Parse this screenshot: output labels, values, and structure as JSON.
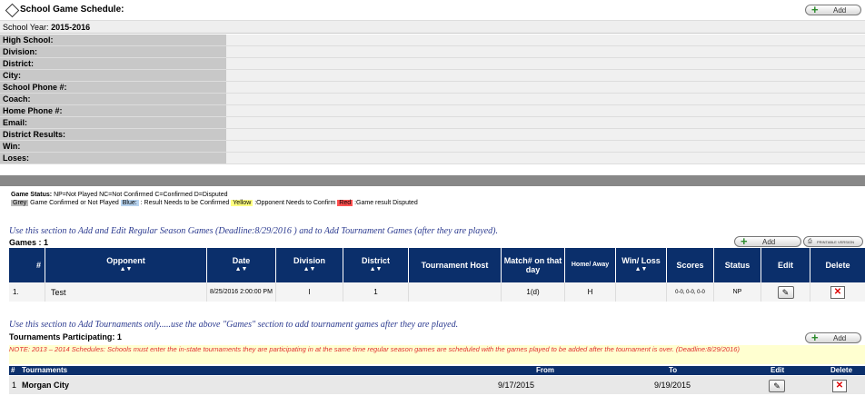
{
  "header": {
    "title": "School Game Schedule:",
    "add_label": "Add"
  },
  "school_year": {
    "label": "School Year:",
    "value": "2015-2016"
  },
  "info_fields": [
    "High School:",
    "Division:",
    "District:",
    "City:",
    "School Phone #:",
    "Coach:",
    "Home Phone #:",
    "Email:",
    "District Results:",
    "Win:",
    "Loses:"
  ],
  "legend": {
    "status_title": "Game Status:",
    "status_text": "NP=Not Played NC=Not Confirmed C=Confirmed D=Disputed",
    "grey": "Grey",
    "grey_text": "Game Confirmed or Not Played",
    "blue": "Blue:",
    "blue_text": ": Result Needs to be Confirmed",
    "yellow": "Yellow",
    "yellow_text": ":Opponent Needs to Confirm",
    "red": "Red",
    "red_text": ":Game result Disputed"
  },
  "games": {
    "instruction": "Use this section to Add and Edit Regular Season Games (Deadline:8/29/2016 ) and to Add Tournament Games (after they are played).",
    "count_label": "Games : 1",
    "add_label": "Add",
    "printable_label": "PRINTABLE VERSION",
    "columns": [
      "#",
      "Opponent",
      "Date",
      "Division",
      "District",
      "Tournament Host",
      "Match# on that day",
      "Home/ Away",
      "Win/ Loss",
      "Scores",
      "Status",
      "Edit",
      "Delete"
    ],
    "sort_arrows": "▲▼",
    "rows": [
      {
        "num": "1.",
        "opponent": "Test",
        "date": "8/25/2016 2:00:00 PM",
        "division": "I",
        "district": "1",
        "host": "",
        "match": "1(d)",
        "home_away": "H",
        "win_loss": "",
        "scores": "0-0, 0-0, 0-0",
        "status": "NP"
      }
    ]
  },
  "tournaments": {
    "instruction": "Use this section to Add Tournaments only.....use the above \"Games\" section to add tournament games after they are played.",
    "count_label": "Tournaments Participating: 1",
    "add_label": "Add",
    "note": "NOTE: 2013 – 2014 Schedules: Schools must enter the in-state tournaments they are participating in at the same time regular season games are scheduled with the games played to be added after the tournament is over. (Deadline:8/29/2016)",
    "columns": [
      "#",
      "Tournaments",
      "From",
      "To",
      "Edit",
      "Delete"
    ],
    "rows": [
      {
        "num": "1",
        "name": "Morgan City",
        "from": "9/17/2015",
        "to": "9/19/2015"
      }
    ]
  },
  "icons": {
    "edit": "pencil-icon",
    "delete": "red-x-icon",
    "add": "green-plus-icon",
    "title": "diamond-icon"
  },
  "colors": {
    "table_header": "#0b2f6b",
    "instruction_text": "#2b3a8f",
    "note_text": "#e03030",
    "note_bg": "#ffffd0"
  }
}
